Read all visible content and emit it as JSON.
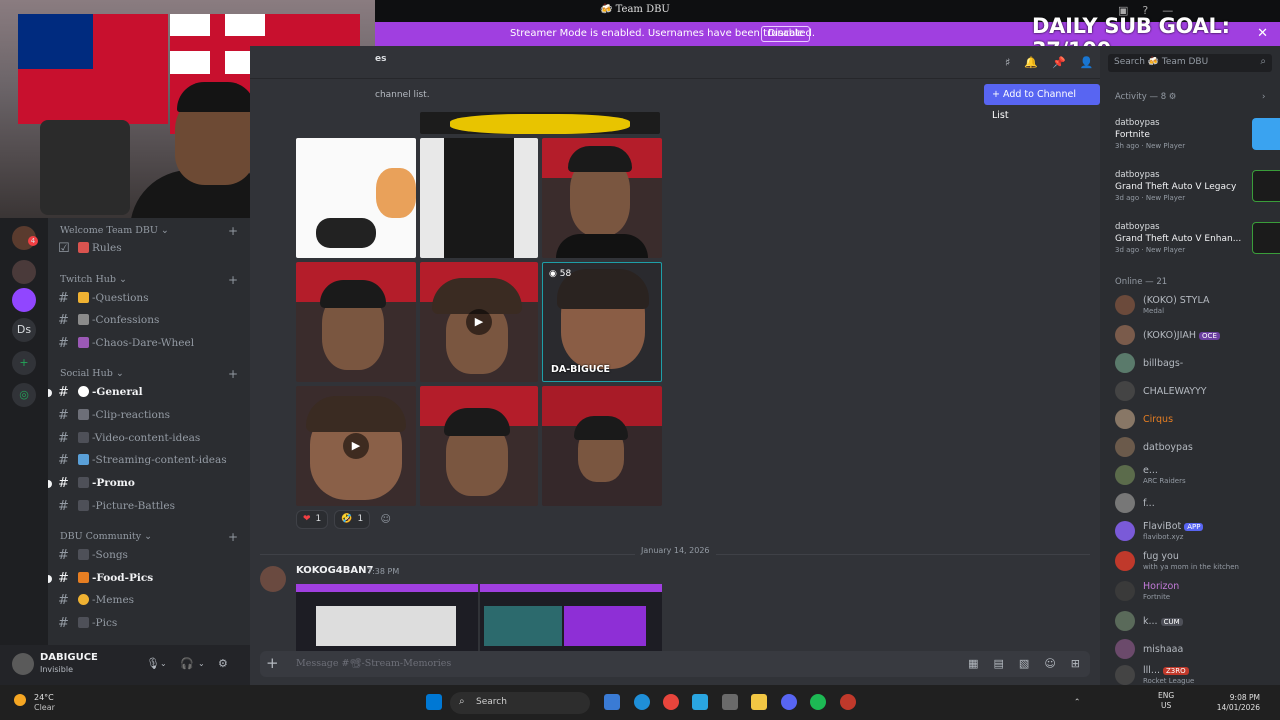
{
  "titlebar": {
    "title": "🍻 Team DBU",
    "sub_goal": "DAILY SUB GOAL: 37/100"
  },
  "banner": {
    "message": "Streamer Mode is enabled. Usernames have been truncated.",
    "disable_label": "Disable"
  },
  "rail": {
    "items": [
      "4",
      "Ds"
    ]
  },
  "sidebar": {
    "categories": [
      {
        "label": "Welcome Team DBU"
      },
      {
        "label": "Twitch Hub"
      },
      {
        "label": "Social Hub"
      },
      {
        "label": "DBU Community"
      }
    ],
    "channels": [
      {
        "name": "Rules"
      },
      {
        "name": "-Questions"
      },
      {
        "name": "-Confessions"
      },
      {
        "name": "-Chaos-Dare-Wheel"
      },
      {
        "name": "-General"
      },
      {
        "name": "-Clip-reactions"
      },
      {
        "name": "-Video-content-ideas"
      },
      {
        "name": "-Streaming-content-ideas"
      },
      {
        "name": "-Promo"
      },
      {
        "name": "-Picture-Battles"
      },
      {
        "name": "-Songs"
      },
      {
        "name": "-Food-Pics"
      },
      {
        "name": "-Memes"
      },
      {
        "name": "-Pics"
      }
    ]
  },
  "user": {
    "name": "DABIGUCE",
    "status": "Invisible"
  },
  "main": {
    "header_fragment": "es",
    "hint": "channel list.",
    "add_button": "Add to Channel List",
    "tile_badge": "58",
    "tile_name": "DA-BIGUCE",
    "reactions": [
      {
        "emoji": "❤",
        "count": "1"
      },
      {
        "emoji": "🤣",
        "count": "1"
      }
    ],
    "date_separator": "January 14, 2026",
    "message2": {
      "author": "KOKOG4BAN7",
      "time": "7:38 PM"
    },
    "composer_placeholder": "Message #📽-Stream-Memories"
  },
  "right_panel": {
    "search": "Search 🍻 Team DBU",
    "activity_header": "Activity — 8",
    "activities": [
      {
        "user": "datboypas",
        "game": "Fortnite",
        "meta": "3h ago",
        "badge": "New Player",
        "thumb_color": "#3aa3f0"
      },
      {
        "user": "datboypas",
        "game": "Grand Theft Auto V Legacy",
        "meta": "3d ago",
        "badge": "New Player",
        "thumb_color": "#1b1b1b"
      },
      {
        "user": "datboypas",
        "game": "Grand Theft Auto V Enhan...",
        "meta": "3d ago",
        "badge": "New Player",
        "thumb_color": "#1b1b1b"
      }
    ],
    "online_header": "Online — 21",
    "members": [
      {
        "name": "(KOKO) STYLA",
        "sub": "Medal",
        "color": "#b5bac1"
      },
      {
        "name": "(KOKO)JIAH",
        "sub": "",
        "tag": "OCE",
        "color": "#b5bac1"
      },
      {
        "name": "billbags-",
        "sub": "",
        "color": "#b5bac1"
      },
      {
        "name": "CHALEWAYYY",
        "sub": "",
        "color": "#b5bac1"
      },
      {
        "name": "Cirqus",
        "sub": "",
        "color": "#e67e22"
      },
      {
        "name": "datboypas",
        "sub": "",
        "color": "#b5bac1"
      },
      {
        "name": "e...",
        "sub": "ARC Raiders",
        "color": "#b5bac1"
      },
      {
        "name": "f...",
        "sub": "",
        "color": "#b5bac1"
      },
      {
        "name": "FlaviBot",
        "sub": "flavibot.xyz",
        "tag": "APP",
        "color": "#b5bac1"
      },
      {
        "name": "fug you",
        "sub": "with ya mom in the kitchen",
        "color": "#b5bac1"
      },
      {
        "name": "Horizon",
        "sub": "Fortnite",
        "color": "#c27ad8"
      },
      {
        "name": "k...",
        "sub": "",
        "tag": "CUM",
        "color": "#b5bac1"
      },
      {
        "name": "mishaaa",
        "sub": "",
        "color": "#b5bac1"
      },
      {
        "name": "lll...",
        "sub": "Rocket League",
        "tag": "Z3RO",
        "color": "#b5bac1"
      }
    ]
  },
  "taskbar": {
    "temp": "24°C",
    "condition": "Clear",
    "search": "Search",
    "lang": "ENG",
    "region": "US",
    "time": "9:08 PM",
    "date": "14/01/2026"
  },
  "colors": {
    "accent": "#5865f2",
    "banner": "#a03fe0",
    "bg": "#313338"
  }
}
